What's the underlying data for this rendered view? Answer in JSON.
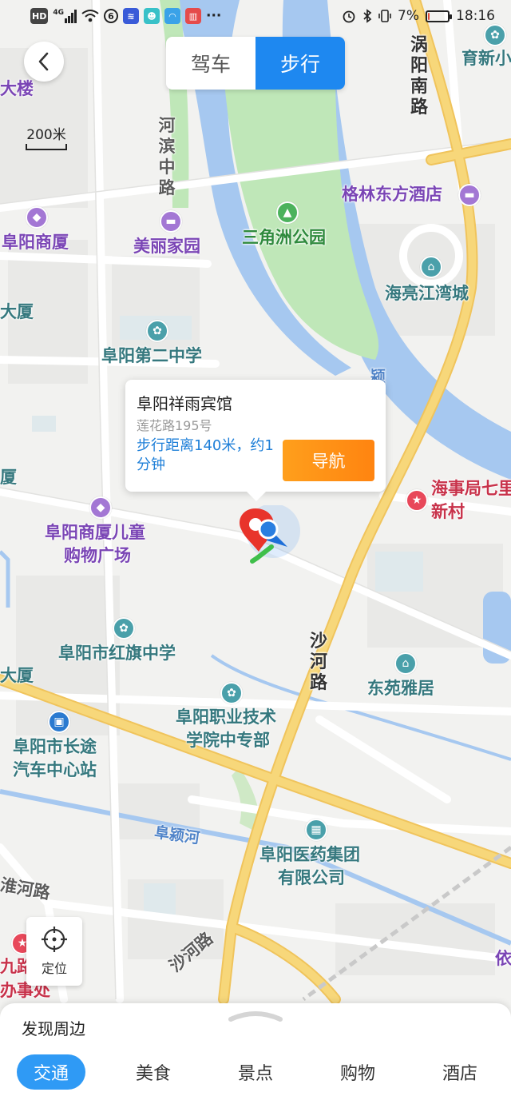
{
  "status_bar": {
    "left_icons": [
      "HD",
      "4G",
      "signal",
      "wifi",
      "app-icon-1",
      "app-icon-2",
      "app-icon-3",
      "app-icon-4",
      "app-icon-5",
      "more"
    ],
    "network": "4G",
    "hd": "HD",
    "more": "···",
    "battery_percent": "7%",
    "battery_level": 0.07,
    "time": "18:16"
  },
  "mode_toggle": {
    "drive_label": "驾车",
    "walk_label": "步行",
    "active": "walk"
  },
  "scale": {
    "label": "200米"
  },
  "map": {
    "labels": {
      "dalou": "大楼",
      "yuxin": "育新小",
      "wo_yang_road": "涡阳南路",
      "he_bin_road": "河滨中路",
      "gelin": "格林东方酒店",
      "fuyang_shangsha": "阜阳商厦",
      "meili_jiayuan": "美丽家园",
      "sanjiaozhou": "三角洲公园",
      "hailiang": "海亮江湾城",
      "dasha_left": "大厦",
      "di_er_zhongxue": "阜阳第二中学",
      "ying_char": "颍",
      "sha_left": "厦",
      "haishi": "海事局七里",
      "xincun": "新村",
      "shangsha_child_1": "阜阳商厦儿童",
      "shangsha_child_2": "购物广场",
      "hongqi": "阜阳市红旗中学",
      "sha_he_road": "沙河路",
      "dongyuan": "东苑雅居",
      "dasha_left2": "大厦",
      "zhiye_1": "阜阳职业技术",
      "zhiye_2": "学院中专部",
      "changtu_1": "阜阳市长途",
      "changtu_2": "汽车中心站",
      "fuying_river": "阜颍河",
      "yiyao_1": "阜阳医药集团",
      "yiyao_2": "有限公司",
      "huaihe_road": "淮河路",
      "sha_he_road_2": "沙河路",
      "jiulong_1": "九路",
      "jiulong_2": "办事处",
      "yi_char": "依"
    }
  },
  "popup": {
    "title": "阜阳祥雨宾馆",
    "address": "莲花路195号",
    "distance": "步行距离140米，约1分钟",
    "nav_button": "导航"
  },
  "locate_button": {
    "label": "定位"
  },
  "bottom_sheet": {
    "title": "发现周边",
    "tabs": [
      "交通",
      "美食",
      "景点",
      "购物",
      "酒店"
    ],
    "active_tab": 0
  },
  "colors": {
    "accent_blue": "#1e88f0",
    "nav_orange": "#ff8c14",
    "tab_active": "#2f9af5",
    "river": "#a6c8f0",
    "park": "#bfe7b8",
    "major_road": "#f7d77a"
  }
}
